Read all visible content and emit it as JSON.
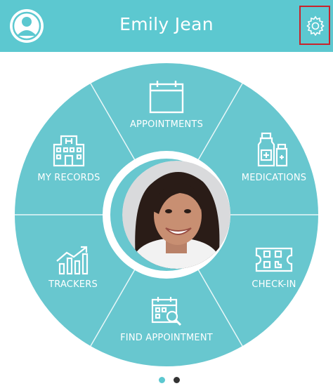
{
  "header": {
    "user_name": "Emily Jean",
    "bg_color": "#5cc8d0",
    "profile_icon": "user-avatar-icon",
    "settings_icon": "gear-icon"
  },
  "wheel": {
    "color": "#68c7cf",
    "segments": [
      {
        "label": "APPOINTMENTS",
        "icon": "calendar-icon"
      },
      {
        "label": "MEDICATIONS",
        "icon": "medication-bottles-icon"
      },
      {
        "label": "CHECK-IN",
        "icon": "qr-ticket-icon"
      },
      {
        "label": "FIND APPOINTMENT",
        "icon": "calendar-search-icon"
      },
      {
        "label": "TRACKERS",
        "icon": "growth-chart-icon"
      },
      {
        "label": "MY RECORDS",
        "icon": "hospital-icon"
      }
    ]
  },
  "pager": {
    "active_color": "#5cc8d0",
    "inactive_color": "#333333",
    "pages": 2,
    "active": 1
  }
}
